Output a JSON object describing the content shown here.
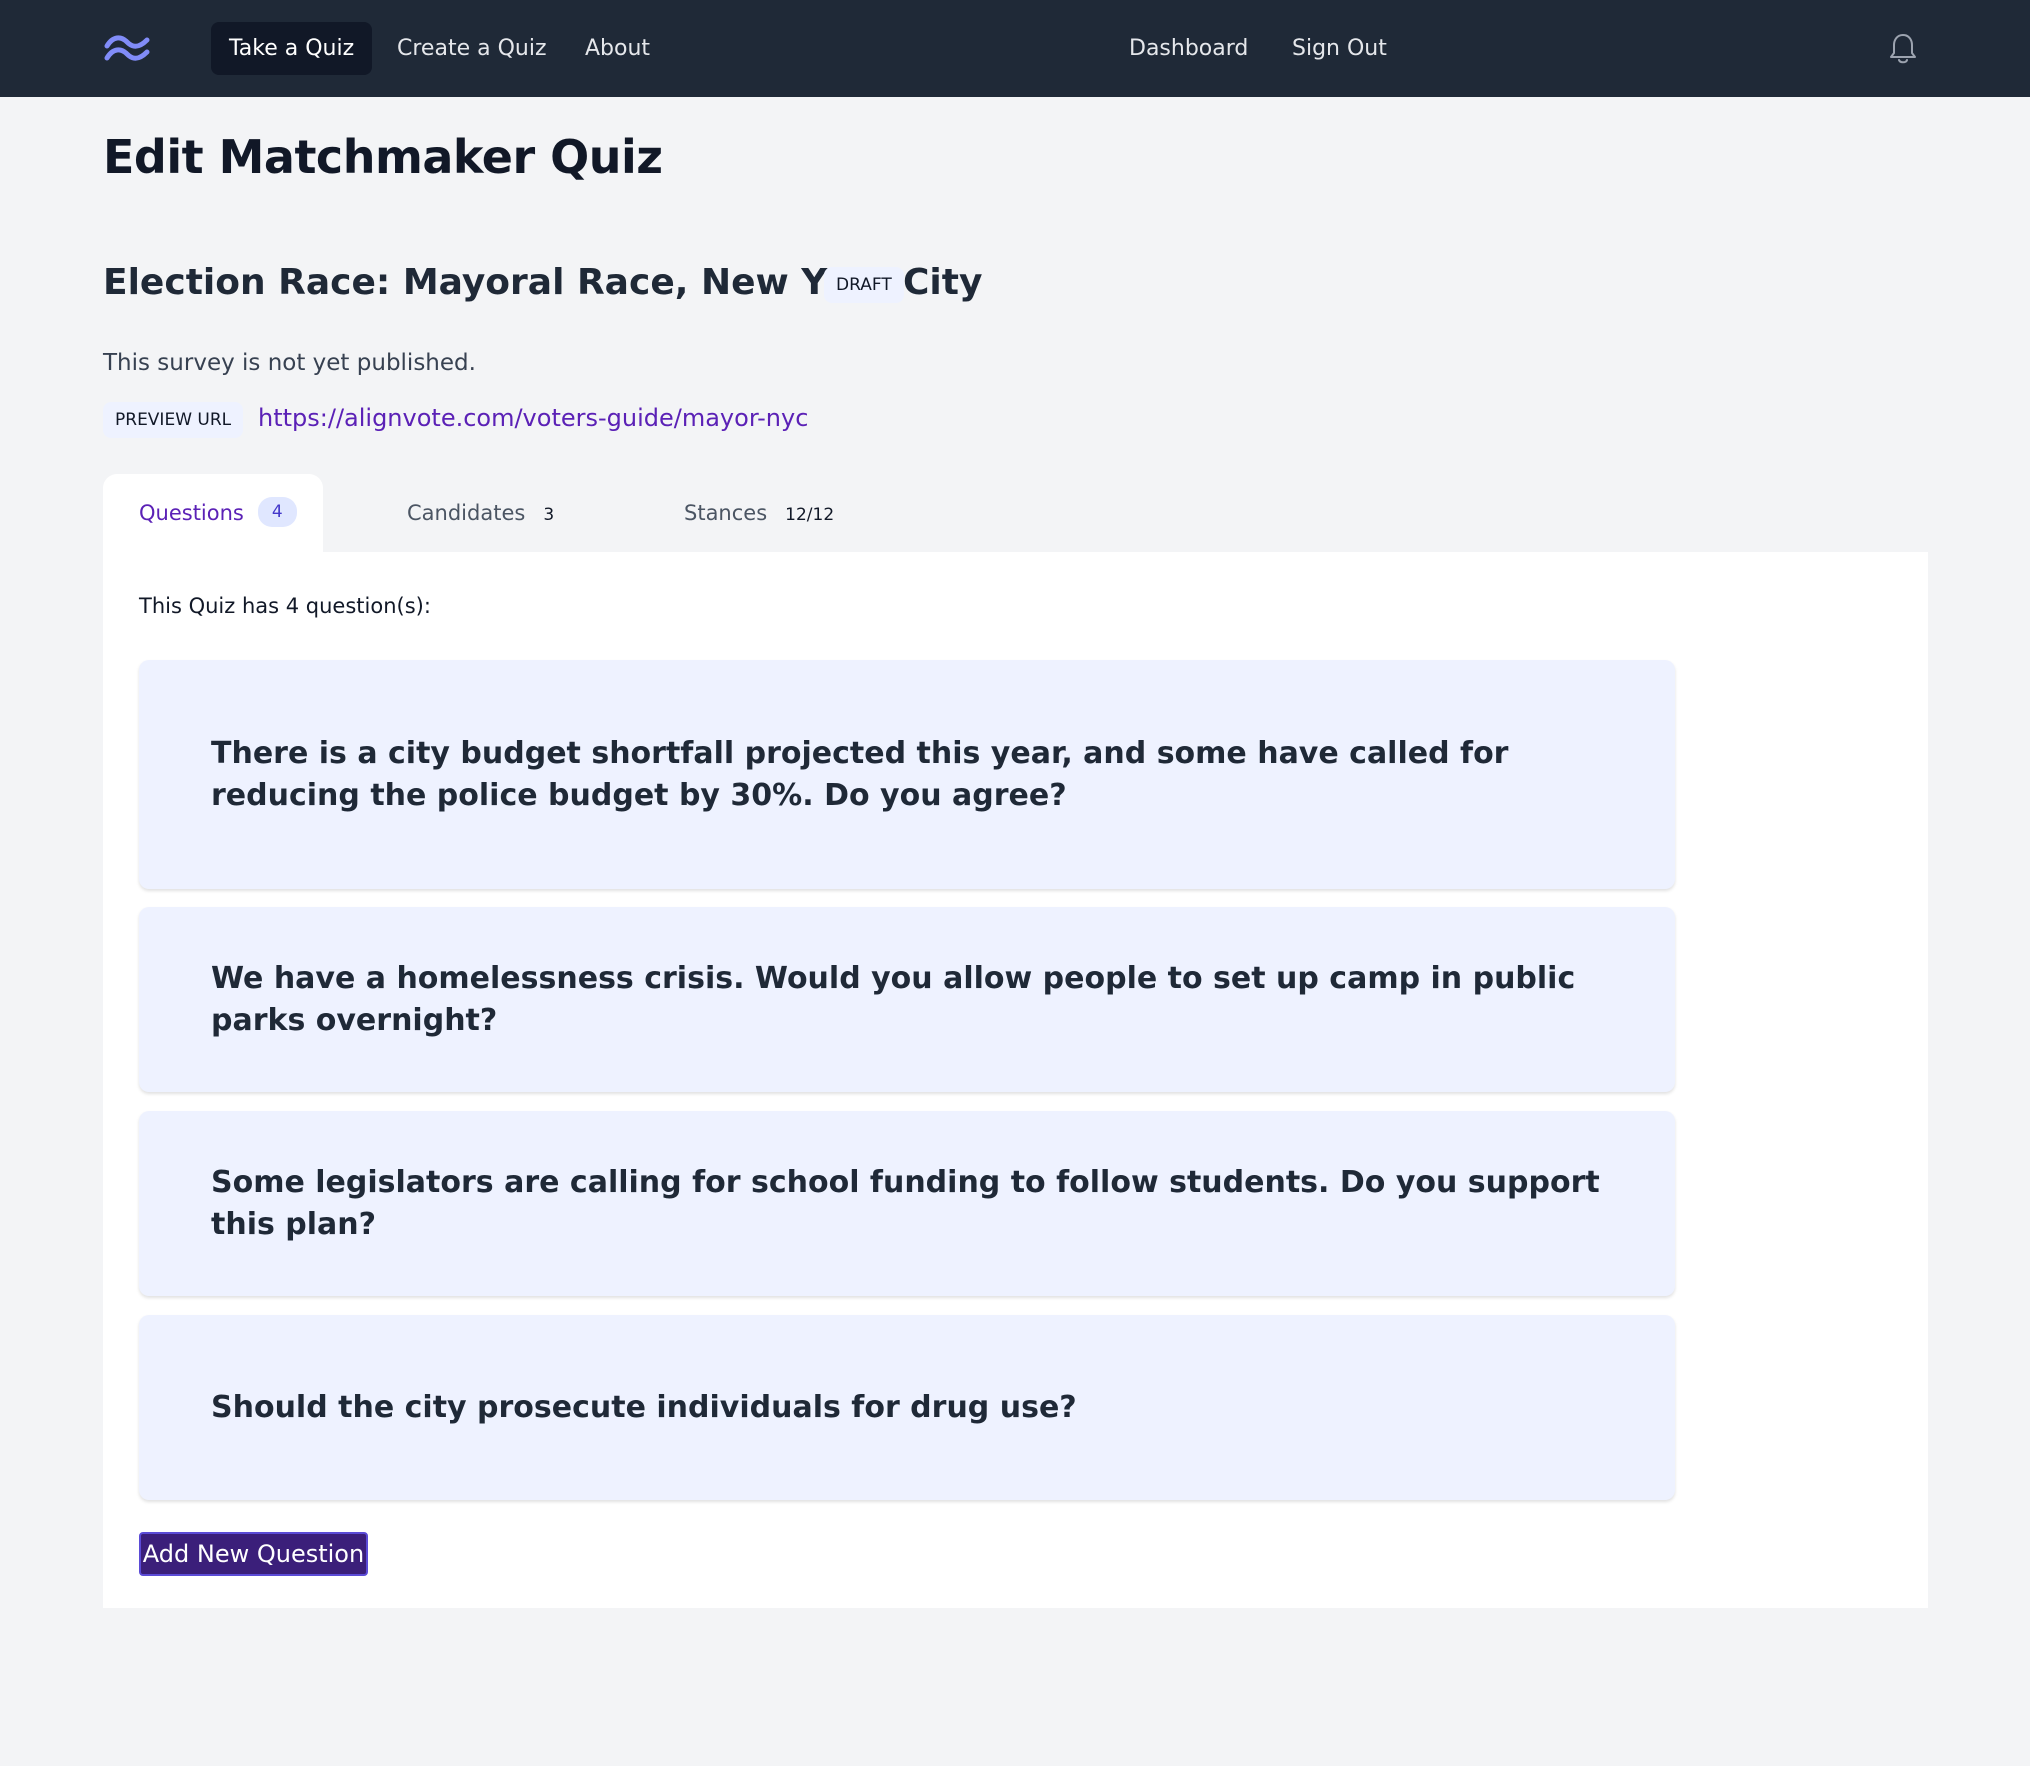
{
  "nav": {
    "logo_icon": "tailwind-wave-icon",
    "links": [
      "Take a Quiz",
      "Create a Quiz",
      "About"
    ],
    "right_links": [
      "Dashboard",
      "Sign Out"
    ],
    "bell_icon": "bell-icon"
  },
  "page": {
    "title": "Edit Matchmaker Quiz",
    "race_title": "Election Race: Mayoral Race, New York City",
    "badge": "DRAFT",
    "status": "This survey is not yet published.",
    "preview_label": "PREVIEW URL",
    "preview_url": "https://alignvote.com/voters-guide/mayor-nyc"
  },
  "tabs": [
    {
      "label": "Questions",
      "count": "4"
    },
    {
      "label": "Candidates",
      "count": "3"
    },
    {
      "label": "Stances",
      "count": "12/12"
    }
  ],
  "questions": {
    "summary": "This Quiz has 4 question(s):",
    "items": [
      "There is a city budget shortfall projected this year, and some have called for reducing the police budget by 30%. Do you agree?",
      "We have a homelessness crisis. Would you allow people to set up camp in public parks overnight?",
      "Some legislators are calling for school funding to follow students. Do you support this plan?",
      "Should the city prosecute individuals for drug use?"
    ],
    "add_button": "Add New Question"
  },
  "colors": {
    "navbar": "#1f2937",
    "accent": "#5b21b6",
    "card": "#eef2ff",
    "button": "#3b1f7a"
  }
}
